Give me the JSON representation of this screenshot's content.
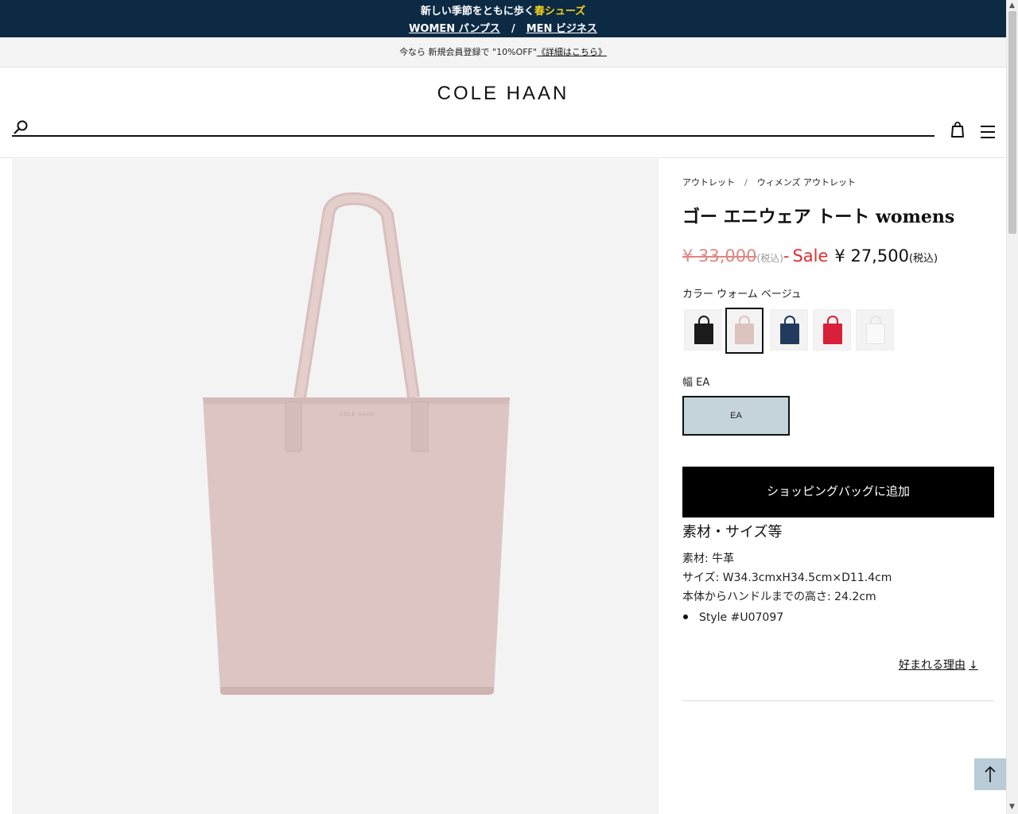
{
  "promo": {
    "line1_text": "新しい季節をともに歩く",
    "line1_highlight": "春シューズ",
    "women_link": "WOMEN パンプス",
    "separator": "/",
    "men_link": "MEN ビジネス"
  },
  "notice": {
    "text": "今なら 新規会員登録で \"10%OFF\"",
    "link": "《詳細はこちら》"
  },
  "header": {
    "logo": "COLE HAAN",
    "search_placeholder": ""
  },
  "breadcrumb": {
    "items": [
      "アウトレット",
      "ウィメンズ アウトレット"
    ],
    "separator": "/"
  },
  "product": {
    "title": "ゴー エニウェア トート womens",
    "original_price": "¥ 33,000",
    "original_tax": "(税込)",
    "dash": "-",
    "sale_label": "Sale",
    "sale_price": "¥ 27,500",
    "sale_tax": "(税込)",
    "color_label": "カラー ウォーム ベージュ",
    "swatches": [
      {
        "name": "black",
        "color": "#1b1b1b"
      },
      {
        "name": "warm-beige",
        "color": "#dcc3c0",
        "selected": true
      },
      {
        "name": "navy",
        "color": "#223a5e"
      },
      {
        "name": "red",
        "color": "#d8203b"
      },
      {
        "name": "white",
        "color": "#f2f2f2"
      }
    ],
    "width_label": "幅 EA",
    "width_option": "EA",
    "add_to_bag": "ショッピングバッグに追加",
    "spec_title": "素材・サイズ等",
    "spec_material": "素材: 牛革",
    "spec_size": "サイズ: W34.3cmxH34.5cm×D11.4cm",
    "spec_handle": "本体からハンドルまでの高さ: 24.2cm",
    "style_number": "Style #U07097",
    "why_link": "好まれる理由",
    "why_arrow": "↓",
    "bag_logo": "COLE HAAN"
  },
  "colors": {
    "promo_bg": "#0c2a44",
    "promo_highlight": "#f3d21a",
    "sale_red": "#e03030",
    "original_price": "#e08585",
    "width_selected_bg": "#c5d3da",
    "bag_color": "#dcc3c1",
    "to_top_bg": "#b9cbd6"
  },
  "icons": {
    "search": "search-icon",
    "bag": "shopping-bag-icon",
    "menu": "hamburger-menu-icon",
    "to_top": "arrow-up-icon"
  }
}
